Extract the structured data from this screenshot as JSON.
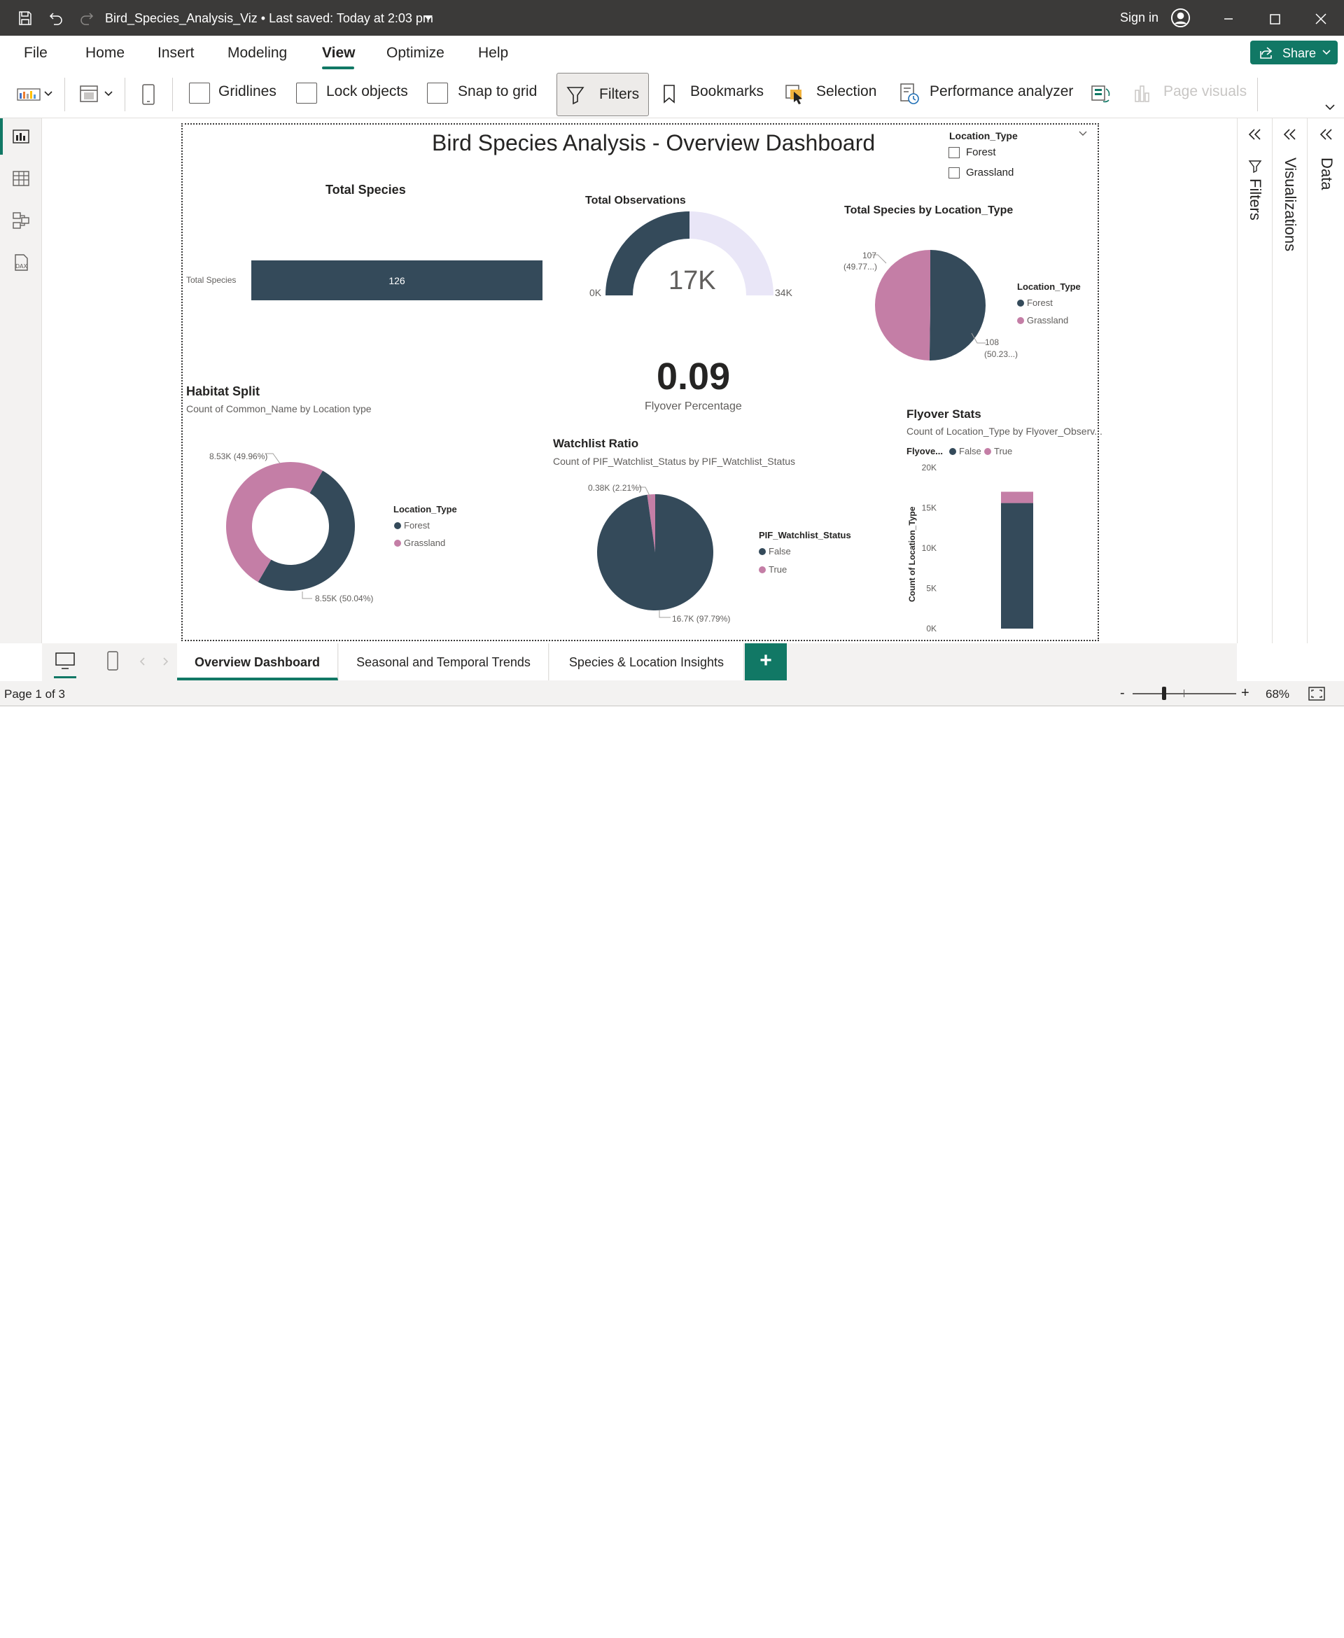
{
  "titlebar": {
    "title": "Bird_Species_Analysis_Viz • Last saved: Today at 2:03 pm",
    "signin": "Sign in"
  },
  "menu": {
    "items": [
      "File",
      "Home",
      "Insert",
      "Modeling",
      "View",
      "Optimize",
      "Help"
    ],
    "active": "View",
    "share": "Share"
  },
  "ribbon": {
    "gridlines": "Gridlines",
    "lock_objects": "Lock objects",
    "snap_to_grid": "Snap to grid",
    "filters": "Filters",
    "bookmarks": "Bookmarks",
    "selection": "Selection",
    "performance_analyzer": "Performance analyzer",
    "page_visuals": "Page visuals"
  },
  "panes": {
    "filters": "Filters",
    "visualizations": "Visualizations",
    "data": "Data"
  },
  "report": {
    "title": "Bird Species Analysis - Overview Dashboard",
    "slicer": {
      "title": "Location_Type",
      "options": [
        "Forest",
        "Grassland"
      ]
    },
    "total_species": {
      "title": "Total Species",
      "category": "Total Species",
      "value_label": "126"
    },
    "total_observations": {
      "title": "Total Observations",
      "value_label": "17K",
      "min_label": "0K",
      "max_label": "34K"
    },
    "flyover_card": {
      "value": "0.09",
      "label": "Flyover Percentage"
    },
    "species_by_location": {
      "title": "Total Species by Location_Type",
      "label_grassland": "107",
      "label_grassland_pct": "(49.77...)",
      "label_forest": "108",
      "label_forest_pct": "(50.23...)",
      "legend_title": "Location_Type",
      "legend": [
        "Forest",
        "Grassland"
      ]
    },
    "habitat_split": {
      "title": "Habitat Split",
      "subtitle": "Count of Common_Name by Location type",
      "label_grassland": "8.53K (49.96%)",
      "label_forest": "8.55K (50.04%)",
      "legend_title": "Location_Type",
      "legend": [
        "Forest",
        "Grassland"
      ]
    },
    "watchlist": {
      "title": "Watchlist Ratio",
      "subtitle": "Count of PIF_Watchlist_Status by PIF_Watchlist_Status",
      "label_true": "0.38K (2.21%)",
      "label_false": "16.7K (97.79%)",
      "legend_title": "PIF_Watchlist_Status",
      "legend": [
        "False",
        "True"
      ]
    },
    "flyover_stats": {
      "title": "Flyover Stats",
      "subtitle": "Count of Location_Type by Flyover_Observ...",
      "legend_title": "Flyove...",
      "legend": [
        "False",
        "True"
      ],
      "ylabel": "Count of Location_Type",
      "ticks": [
        "20K",
        "15K",
        "10K",
        "5K",
        "0K"
      ]
    }
  },
  "colors": {
    "navy": "#344a5a",
    "pink": "#c47ea6",
    "gauge_bg": "#e9e6f7",
    "accent": "#117865"
  },
  "tabs": [
    "Overview Dashboard",
    "Seasonal and Temporal Trends",
    "Species & Location Insights"
  ],
  "status": {
    "page": "Page 1 of 3",
    "zoom": "68%",
    "zoom_minus": "-",
    "zoom_plus": "+"
  },
  "chart_data": [
    {
      "type": "bar",
      "title": "Total Species",
      "categories": [
        "Total Species"
      ],
      "values": [
        126
      ]
    },
    {
      "type": "gauge",
      "title": "Total Observations",
      "value": 17000,
      "min": 0,
      "max": 34000
    },
    {
      "type": "pie",
      "title": "Total Species by Location_Type",
      "categories": [
        "Forest",
        "Grassland"
      ],
      "values": [
        108,
        107
      ],
      "percentages": [
        50.23,
        49.77
      ]
    },
    {
      "type": "pie",
      "title": "Habitat Split",
      "subtitle": "Count of Common_Name by Location type",
      "donut": true,
      "categories": [
        "Forest",
        "Grassland"
      ],
      "values": [
        8550,
        8530
      ],
      "percentages": [
        50.04,
        49.96
      ]
    },
    {
      "type": "pie",
      "title": "Watchlist Ratio",
      "subtitle": "Count of PIF_Watchlist_Status by PIF_Watchlist_Status",
      "categories": [
        "False",
        "True"
      ],
      "values": [
        16700,
        380
      ],
      "percentages": [
        97.79,
        2.21
      ]
    },
    {
      "type": "bar",
      "stacked": true,
      "title": "Flyover Stats",
      "subtitle": "Count of Location_Type by Flyover_Observ...",
      "ylabel": "Count of Location_Type",
      "ylim": [
        0,
        20000
      ],
      "series": [
        {
          "name": "False",
          "values": [
            15600
          ]
        },
        {
          "name": "True",
          "values": [
            1400
          ]
        }
      ]
    }
  ]
}
